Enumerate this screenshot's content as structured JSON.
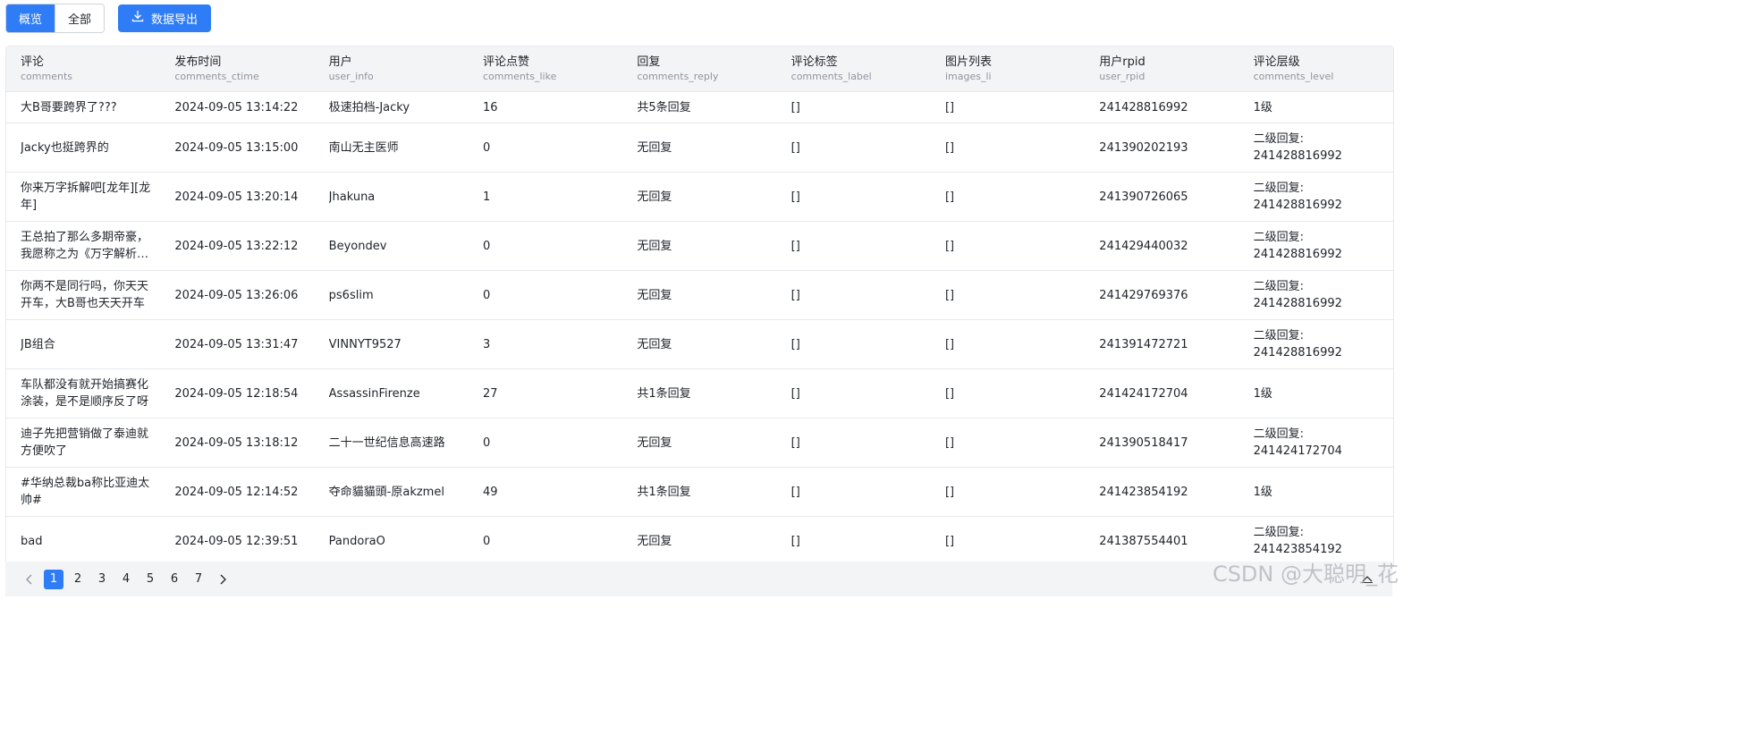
{
  "toolbar": {
    "tabs": [
      {
        "label": "概览",
        "active": true
      },
      {
        "label": "全部",
        "active": false
      }
    ],
    "export_label": "数据导出",
    "export_icon": "download-icon"
  },
  "colors": {
    "accent": "#2f7df6",
    "header_bg": "#f3f4f6",
    "border": "#e6e8eb"
  },
  "table": {
    "columns": [
      {
        "label": "评论",
        "key": "comments"
      },
      {
        "label": "发布时间",
        "key": "comments_ctime"
      },
      {
        "label": "用户",
        "key": "user_info"
      },
      {
        "label": "评论点赞",
        "key": "comments_like"
      },
      {
        "label": "回复",
        "key": "comments_reply"
      },
      {
        "label": "评论标签",
        "key": "comments_label"
      },
      {
        "label": "图片列表",
        "key": "images_li"
      },
      {
        "label": "用户rpid",
        "key": "user_rpid"
      },
      {
        "label": "评论层级",
        "key": "comments_level"
      }
    ],
    "rows": [
      [
        "大B哥要跨界了???",
        "2024-09-05 13:14:22",
        "极速拍档-Jacky",
        "16",
        "共5条回复",
        "[]",
        "[]",
        "241428816992",
        "1级"
      ],
      [
        "Jacky也挺跨界的",
        "2024-09-05 13:15:00",
        "南山无主医师",
        "0",
        "无回复",
        "[]",
        "[]",
        "241390202193",
        "二级回复: 241428816992"
      ],
      [
        "你来万字拆解吧[龙年][龙年]",
        "2024-09-05 13:20:14",
        "Jhakuna",
        "1",
        "无回复",
        "[]",
        "[]",
        "241390726065",
        "二级回复: 241428816992"
      ],
      [
        "王总拍了那么多期帝豪，我愿称之为《万字解析吉利帝豪》",
        "2024-09-05 13:22:12",
        "Beyondev",
        "0",
        "无回复",
        "[]",
        "[]",
        "241429440032",
        "二级回复: 241428816992"
      ],
      [
        "你两不是同行吗，你天天开车，大B哥也天天开车",
        "2024-09-05 13:26:06",
        "ps6slim",
        "0",
        "无回复",
        "[]",
        "[]",
        "241429769376",
        "二级回复: 241428816992"
      ],
      [
        "JB组合",
        "2024-09-05 13:31:47",
        "VINNYT9527",
        "3",
        "无回复",
        "[]",
        "[]",
        "241391472721",
        "二级回复: 241428816992"
      ],
      [
        "车队都没有就开始搞赛化涂装，是不是顺序反了呀",
        "2024-09-05 12:18:54",
        "AssassinFirenze",
        "27",
        "共1条回复",
        "[]",
        "[]",
        "241424172704",
        "1级"
      ],
      [
        "迪子先把营销做了泰迪就方便吹了",
        "2024-09-05 13:18:12",
        "二十一世纪信息高速路",
        "0",
        "无回复",
        "[]",
        "[]",
        "241390518417",
        "二级回复: 241424172704"
      ],
      [
        "#华纳总裁ba称比亚迪太帅#",
        "2024-09-05 12:14:52",
        "夺命貓貓頭-原akzmel",
        "49",
        "共1条回复",
        "[]",
        "[]",
        "241423854192",
        "1级"
      ],
      [
        "bad",
        "2024-09-05 12:39:51",
        "PandoraO",
        "0",
        "无回复",
        "[]",
        "[]",
        "241387554401",
        "二级回复: 241423854192"
      ]
    ],
    "row_heights": [
      "single",
      "double",
      "double",
      "double",
      "double",
      "double",
      "double",
      "double",
      "double",
      "double"
    ]
  },
  "pagination": {
    "prev_icon": "chevron-left-icon",
    "next_icon": "chevron-right-icon",
    "pages": [
      "1",
      "2",
      "3",
      "4",
      "5",
      "6",
      "7"
    ],
    "current": "1"
  },
  "scroll_top_icon": "caret-up-icon",
  "watermark": "CSDN @大聪明_花"
}
